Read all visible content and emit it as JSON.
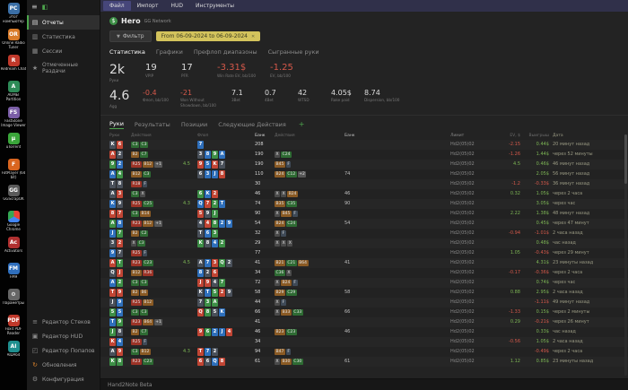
{
  "icons": {
    "menu": "≡",
    "logo": "◧",
    "funnel": "▼",
    "close": "✕",
    "plus": "+",
    "hero_badge": "$"
  },
  "desktop": {
    "icons": [
      {
        "id": "this-pc",
        "label": "Этот компьютер",
        "glyph": "PC",
        "color": "#3a6ea5"
      },
      {
        "id": "online-radio",
        "label": "Online Radio Tuner",
        "glyph": "OR",
        "color": "#d97b29"
      },
      {
        "id": "redream",
        "label": "Redream Chat",
        "glyph": "R",
        "color": "#c0392b"
      },
      {
        "id": "aomei",
        "label": "AOMEI Partition",
        "glyph": "A",
        "color": "#2e8b57"
      },
      {
        "id": "faststone",
        "label": "FastStone Image Viewer",
        "glyph": "FS",
        "color": "#7b5ea7"
      },
      {
        "id": "utorrent",
        "label": "uTorrent",
        "glyph": "µ",
        "color": "#3aa63a"
      },
      {
        "id": "fotplayer",
        "label": "FotPlayer (64 bit)",
        "glyph": "F",
        "color": "#d9651f"
      },
      {
        "id": "ggscrapok",
        "label": "GGScrapOK",
        "glyph": "GG",
        "color": "#5a5a5a"
      },
      {
        "id": "chrome",
        "label": "Google Chrome",
        "glyph": "",
        "color": "conic-gradient(#ea4335 0 33%, #4285f4 33% 66%, #34a853 66% 100%)"
      },
      {
        "id": "activators",
        "label": "Activators",
        "glyph": "Ac",
        "color": "#b03030"
      },
      {
        "id": "fm9",
        "label": "FM9",
        "glyph": "FM",
        "color": "#2f6fbd"
      },
      {
        "id": "params",
        "label": "Параметры",
        "glyph": "⚙",
        "color": "#666666"
      },
      {
        "id": "pdf-reader",
        "label": "Foxit PDF Reader",
        "glyph": "PDF",
        "color": "#c0392b"
      },
      {
        "id": "aida64",
        "label": "AIDA64",
        "glyph": "AI",
        "color": "#1f8f8f"
      }
    ]
  },
  "sidebar": {
    "active": "reports",
    "items": [
      {
        "id": "reports",
        "label": "Отчеты",
        "glyph": "▤"
      },
      {
        "id": "statistics",
        "label": "Статистика",
        "glyph": "▥"
      },
      {
        "id": "sessions",
        "label": "Сессии",
        "glyph": "▦"
      },
      {
        "id": "marked-hands",
        "label": "Отмеченные Раздачи",
        "glyph": "★"
      }
    ],
    "bottom_items": [
      {
        "id": "stack-editor",
        "label": "Редактор Стеков",
        "glyph": "≡"
      },
      {
        "id": "hud-editor",
        "label": "Редактор HUD",
        "glyph": "▣"
      },
      {
        "id": "popup-editor",
        "label": "Редактор Попапов",
        "glyph": "◰"
      },
      {
        "id": "updates",
        "label": "Обновления",
        "glyph": "↻",
        "glyph_color": "#d9822b"
      },
      {
        "id": "configuration",
        "label": "Конфигурация",
        "glyph": "⚙"
      }
    ]
  },
  "menubar": {
    "active": "file",
    "items": [
      {
        "id": "file",
        "label": "Файл"
      },
      {
        "id": "import",
        "label": "Импорт"
      },
      {
        "id": "hud",
        "label": "HUD"
      },
      {
        "id": "tools",
        "label": "Инструменты"
      }
    ]
  },
  "player": {
    "name": "Hero",
    "network": "GG Network"
  },
  "filter": {
    "button_label": "Фильтр",
    "date_range": "From 06-09-2024 to 06-09-2024"
  },
  "view_tabs": {
    "active": "statistics",
    "items": [
      {
        "id": "statistics",
        "label": "Статистика"
      },
      {
        "id": "graphs",
        "label": "Графики"
      },
      {
        "id": "preflop-ranges",
        "label": "Префлоп диапазоны"
      },
      {
        "id": "played-hands",
        "label": "Сыгранные руки"
      }
    ]
  },
  "stats_primary": [
    {
      "id": "hands",
      "value": "2k",
      "label": "Руки"
    },
    {
      "id": "vpip",
      "value": "19",
      "label": "VPIP"
    },
    {
      "id": "pfr",
      "value": "17",
      "label": "PFR"
    },
    {
      "id": "winrate",
      "value": "-3.31$",
      "label": "Win Rate EV, bb/100",
      "negative": true
    },
    {
      "id": "ev-bb",
      "value": "-1.25",
      "label": "EV, bb/100",
      "negative": true
    }
  ],
  "stats_secondary": [
    {
      "id": "agg",
      "value": "4.6",
      "label": "Agg"
    },
    {
      "id": "flop-bb",
      "value": "-0.4",
      "label": "Флоп, bb/100",
      "negative": true
    },
    {
      "id": "wwsf",
      "value": "-21",
      "label": "Won Without Showdown, bb/100",
      "negative": true
    },
    {
      "id": "3bet",
      "value": "7.1",
      "label": "3Bet"
    },
    {
      "id": "4bet",
      "value": "0.7",
      "label": "4Bet"
    },
    {
      "id": "wtsd",
      "value": "42",
      "label": "WTSD"
    },
    {
      "id": "rake",
      "value": "4.05$",
      "label": "Rake paid"
    },
    {
      "id": "dispersion",
      "value": "8.74",
      "label": "Dispersion, bb/100"
    }
  ],
  "table": {
    "active_tab": "hands",
    "tabs": [
      {
        "id": "hands",
        "label": "Руки"
      },
      {
        "id": "results",
        "label": "Результаты"
      },
      {
        "id": "positions",
        "label": "Позиции"
      },
      {
        "id": "next-actions",
        "label": "Следующие Действия"
      }
    ],
    "headers": [
      "Руки",
      "Действия",
      "",
      "Флоп",
      "Банк",
      "Действия",
      "Банк",
      "Лимит",
      "EV, $",
      "Выигрыш",
      "Дата"
    ],
    "rows": [
      {
        "c": [
          "Ks",
          "6h"
        ],
        "pre": "C3 C3",
        "mid": "",
        "b": [
          "7d"
        ],
        "pot": "208",
        "post": "",
        "pot2": "",
        "stake": "Hd2(05)02",
        "ev": "-2.15",
        "won": "0.44$",
        "t": "20 минут назад"
      },
      {
        "c": [
          "Ah",
          "2s"
        ],
        "pre": "B2 C7",
        "mid": "",
        "b": [
          "3s",
          "8d",
          "9c",
          "Ad"
        ],
        "pot": "190",
        "post": "X C24",
        "pot2": "",
        "stake": "Hd2(05)02",
        "ev": "-1.26",
        "won": "1.44$",
        "t": "через 52 минуты"
      },
      {
        "c": [
          "9c",
          "2d"
        ],
        "pre": "R25 B12 +1",
        "mid": "4.5",
        "b": [
          "9h",
          "5d",
          "Kh",
          "7s"
        ],
        "pot": "190",
        "post": "B45 F",
        "pot2": "",
        "stake": "Hd2(05)02",
        "ev": "4.5",
        "won": "0.46$",
        "t": "46 минут назад"
      },
      {
        "c": [
          "Ad",
          "4c"
        ],
        "pre": "B12 C3",
        "mid": "",
        "b": [
          "6s",
          "3d",
          "Jd",
          "8h"
        ],
        "pot": "110",
        "post": "B24 C12 +2",
        "pot2": "74",
        "stake": "Hd2(05)02",
        "ev": "",
        "won": "2.05$",
        "t": "56 минут назад"
      },
      {
        "c": [
          "Ts",
          "8s"
        ],
        "pre": "R18 F",
        "mid": "",
        "b": [],
        "pot": "30",
        "post": "",
        "pot2": "",
        "stake": "Hd2(05)02",
        "ev": "-1.2",
        "won": "-0.33$",
        "t": "36 минут назад"
      },
      {
        "c": [
          "As",
          "3h"
        ],
        "pre": "C3 X",
        "mid": "",
        "b": [
          "6c",
          "Kd",
          "2h"
        ],
        "pot": "46",
        "post": "X X B24",
        "pot2": "46",
        "stake": "Hd2(05)02",
        "ev": "0.32",
        "won": "1.05$",
        "t": "через 2 часа"
      },
      {
        "c": [
          "Kd",
          "9s"
        ],
        "pre": "R25 C25",
        "mid": "4.3",
        "b": [
          "Qd",
          "7h",
          "2c",
          "Td"
        ],
        "pot": "74",
        "post": "B35 C35",
        "pot2": "90",
        "stake": "Hd2(05)02",
        "ev": "",
        "won": "3.05$",
        "t": "через час"
      },
      {
        "c": [
          "8h",
          "7h"
        ],
        "pre": "C3 B14",
        "mid": "",
        "b": [
          "5h",
          "9s",
          "Jc"
        ],
        "pot": "90",
        "post": "X B45 F",
        "pot2": "",
        "stake": "Hd2(05)02",
        "ev": "2.22",
        "won": "1.38$",
        "t": "48 минут назад"
      },
      {
        "c": [
          "Ac",
          "8d"
        ],
        "pre": "R23 B12 +1",
        "mid": "",
        "b": [
          "4s",
          "4h",
          "8c",
          "2d",
          "9d"
        ],
        "pot": "54",
        "post": "B24 C24",
        "pot2": "54",
        "stake": "Hd2(05)02",
        "ev": "",
        "won": "0.45$",
        "t": "через 47 минут"
      },
      {
        "c": [
          "Jd",
          "7c"
        ],
        "pre": "B2 C2",
        "mid": "",
        "b": [
          "Ts",
          "6d",
          "3c"
        ],
        "pot": "32",
        "post": "X F",
        "pot2": "",
        "stake": "Hd2(05)02",
        "ev": "-0.94",
        "won": "-1.01$",
        "t": "2 часа назад"
      },
      {
        "c": [
          "3s",
          "2h"
        ],
        "pre": "X C3",
        "mid": "",
        "b": [
          "Kc",
          "8s",
          "4d",
          "2c"
        ],
        "pot": "29",
        "post": "X X X",
        "pot2": "",
        "stake": "Hd2(05)02",
        "ev": "",
        "won": "0.48$",
        "t": "час назад"
      },
      {
        "c": [
          "9d",
          "7s"
        ],
        "pre": "R25 F",
        "mid": "",
        "b": [],
        "pot": "77",
        "post": "",
        "pot2": "",
        "stake": "Hd2(05)02",
        "ev": "1.05",
        "won": "-0.43$",
        "t": "через 29 минут"
      },
      {
        "c": [
          "Ah",
          "Tc"
        ],
        "pre": "R23 C23",
        "mid": "4.5",
        "b": [
          "As",
          "7d",
          "3h",
          "Qc",
          "2s"
        ],
        "pot": "41",
        "post": "B21 C21 B64",
        "pot2": "41",
        "stake": "Hd2(05)02",
        "ev": "",
        "won": "4.31$",
        "t": "23 минуты назад"
      },
      {
        "c": [
          "Qs",
          "Jh"
        ],
        "pre": "B12 R36",
        "mid": "",
        "b": [
          "8d",
          "2s",
          "6h"
        ],
        "pot": "34",
        "post": "C36 X",
        "pot2": "",
        "stake": "Hd2(05)02",
        "ev": "-0.17",
        "won": "-0.36$",
        "t": "через 2 часа"
      },
      {
        "c": [
          "Ad",
          "2c"
        ],
        "pre": "C3 C3",
        "mid": "",
        "b": [
          "Jh",
          "9h",
          "4s",
          "7c"
        ],
        "pot": "72",
        "post": "X B24 F",
        "pot2": "",
        "stake": "Hd2(05)02",
        "ev": "",
        "won": "0.74$",
        "t": "через час"
      },
      {
        "c": [
          "Th",
          "9h"
        ],
        "pre": "B2 B6",
        "mid": "",
        "b": [
          "Ks",
          "Td",
          "5c",
          "2h",
          "9s"
        ],
        "pot": "58",
        "post": "B29 C29",
        "pot2": "58",
        "stake": "Hd2(05)02",
        "ev": "0.88",
        "won": "2.95$",
        "t": "2 часа назад"
      },
      {
        "c": [
          "Js",
          "9d"
        ],
        "pre": "R25 B12",
        "mid": "",
        "b": [
          "7s",
          "3c",
          "Ac"
        ],
        "pot": "44",
        "post": "X F",
        "pot2": "",
        "stake": "Hd2(05)02",
        "ev": "",
        "won": "-1.11$",
        "t": "49 минут назад"
      },
      {
        "c": [
          "5c",
          "5d"
        ],
        "pre": "C3 C3",
        "mid": "",
        "b": [
          "Qh",
          "8c",
          "5s",
          "Kd"
        ],
        "pot": "66",
        "post": "X B33 C33",
        "pot2": "66",
        "stake": "Hd2(05)02",
        "ev": "-1.33",
        "won": "0.15$",
        "t": "через 2 минуты"
      },
      {
        "c": [
          "Td",
          "9c"
        ],
        "pre": "R23 B64 +1",
        "mid": "",
        "b": [],
        "pot": "41",
        "post": "",
        "pot2": "",
        "stake": "Hd2(05)02",
        "ev": "0.29",
        "won": "-0.21$",
        "t": "через 26 минут"
      },
      {
        "c": [
          "Jc",
          "8s"
        ],
        "pre": "B2 C7",
        "mid": "",
        "b": [
          "9h",
          "6c",
          "2d",
          "Jd",
          "4h"
        ],
        "pot": "46",
        "post": "B23 C23",
        "pot2": "46",
        "stake": "Hd2(05)02",
        "ev": "",
        "won": "0.33$",
        "t": "час назад"
      },
      {
        "c": [
          "Kh",
          "4d"
        ],
        "pre": "R25 F",
        "mid": "",
        "b": [],
        "pot": "34",
        "post": "",
        "pot2": "",
        "stake": "Hd2(05)02",
        "ev": "-0.56",
        "won": "1.05$",
        "t": "2 часа назад"
      },
      {
        "c": [
          "As",
          "9h"
        ],
        "pre": "C3 B12",
        "mid": "4.3",
        "b": [
          "Th",
          "7d",
          "2s"
        ],
        "pot": "94",
        "post": "B47 F",
        "pot2": "",
        "stake": "Hd2(05)02",
        "ev": "",
        "won": "-0.49$",
        "t": "через 2 часа"
      },
      {
        "c": [
          "Kc",
          "8c"
        ],
        "pre": "R23 C23",
        "mid": "",
        "b": [
          "6h",
          "6s",
          "Qd",
          "8h"
        ],
        "pot": "61",
        "post": "X B30 C30",
        "pot2": "61",
        "stake": "Hd2(05)02",
        "ev": "1.12",
        "won": "0.85$",
        "t": "23 минуты назад"
      }
    ]
  },
  "statusbar": {
    "text": "Hand2Note Beta"
  }
}
